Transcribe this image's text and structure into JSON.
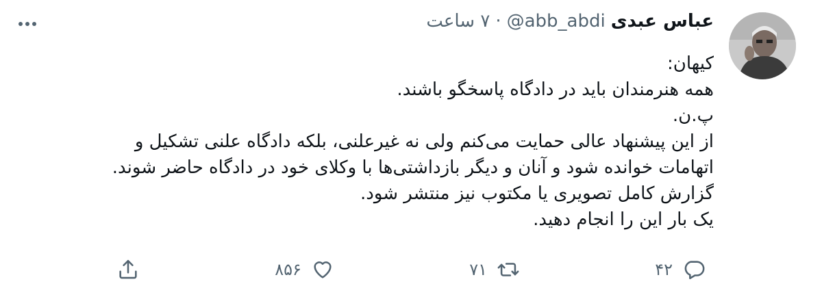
{
  "tweet": {
    "display_name": "عباس عبدی",
    "handle": "@abb_abdi",
    "separator": "·",
    "time": "۷ ساعت",
    "lines": [
      "کیهان:",
      "همه هنرمندان باید در دادگاه پاسخگو باشند.",
      "پ.ن.",
      "از این پیشنهاد عالی حمایت می‌کنم ولی نه غیرعلنی، بلکه دادگاه علنی تشکیل و",
      "اتهامات خوانده شود و آنان و دیگر بازداشتی‌ها با وکلای خود در دادگاه حاضر شوند.",
      "گزارش کامل تصویری یا مکتوب نیز منتشر شود.",
      "یک بار این را انجام دهید."
    ],
    "replies": "۴۲",
    "retweets": "۷۱",
    "likes": "۸۵۶"
  },
  "icons": {
    "more": "more-dots-icon",
    "reply": "reply-bubble-icon",
    "retweet": "retweet-arrows-icon",
    "like": "heart-icon",
    "share": "share-upload-icon"
  },
  "colors": {
    "text": "#0f1419",
    "secondary": "#536471",
    "background": "#ffffff"
  }
}
